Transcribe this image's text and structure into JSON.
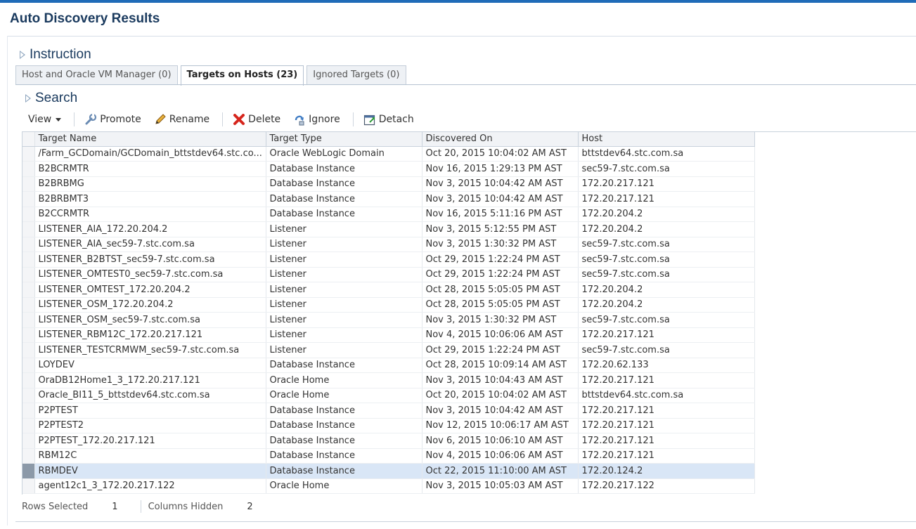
{
  "page": {
    "title": "Auto Discovery Results"
  },
  "instruction": {
    "label": "Instruction"
  },
  "search": {
    "label": "Search"
  },
  "tabs": [
    {
      "label": "Host and Oracle VM Manager (0)",
      "active": false
    },
    {
      "label": "Targets on Hosts (23)",
      "active": true
    },
    {
      "label": "Ignored Targets (0)",
      "active": false
    }
  ],
  "toolbar": {
    "view": "View",
    "promote": "Promote",
    "rename": "Rename",
    "delete": "Delete",
    "ignore": "Ignore",
    "detach": "Detach"
  },
  "table": {
    "columns": [
      "Target Name",
      "Target Type",
      "Discovered On",
      "Host"
    ],
    "rows": [
      [
        "/Farm_GCDomain/GCDomain_bttstdev64.stc.co...",
        "Oracle WebLogic Domain",
        "Oct 20, 2015 10:04:02 AM AST",
        "bttstdev64.stc.com.sa"
      ],
      [
        "B2BCRMTR",
        "Database Instance",
        "Nov 16, 2015 1:29:13 PM AST",
        "sec59-7.stc.com.sa"
      ],
      [
        "B2BRBMG",
        "Database Instance",
        "Nov 3, 2015 10:04:42 AM AST",
        "172.20.217.121"
      ],
      [
        "B2BRBMT3",
        "Database Instance",
        "Nov 3, 2015 10:04:42 AM AST",
        "172.20.217.121"
      ],
      [
        "B2CCRMTR",
        "Database Instance",
        "Nov 16, 2015 5:11:16 PM AST",
        "172.20.204.2"
      ],
      [
        "LISTENER_AIA_172.20.204.2",
        "Listener",
        "Nov 3, 2015 5:12:55 PM AST",
        "172.20.204.2"
      ],
      [
        "LISTENER_AIA_sec59-7.stc.com.sa",
        "Listener",
        "Nov 3, 2015 1:30:32 PM AST",
        "sec59-7.stc.com.sa"
      ],
      [
        "LISTENER_B2BTST_sec59-7.stc.com.sa",
        "Listener",
        "Oct 29, 2015 1:22:24 PM AST",
        "sec59-7.stc.com.sa"
      ],
      [
        "LISTENER_OMTEST0_sec59-7.stc.com.sa",
        "Listener",
        "Oct 29, 2015 1:22:24 PM AST",
        "sec59-7.stc.com.sa"
      ],
      [
        "LISTENER_OMTEST_172.20.204.2",
        "Listener",
        "Oct 28, 2015 5:05:05 PM AST",
        "172.20.204.2"
      ],
      [
        "LISTENER_OSM_172.20.204.2",
        "Listener",
        "Oct 28, 2015 5:05:05 PM AST",
        "172.20.204.2"
      ],
      [
        "LISTENER_OSM_sec59-7.stc.com.sa",
        "Listener",
        "Nov 3, 2015 1:30:32 PM AST",
        "sec59-7.stc.com.sa"
      ],
      [
        "LISTENER_RBM12C_172.20.217.121",
        "Listener",
        "Nov 4, 2015 10:06:06 AM AST",
        "172.20.217.121"
      ],
      [
        "LISTENER_TESTCRMWM_sec59-7.stc.com.sa",
        "Listener",
        "Oct 29, 2015 1:22:24 PM AST",
        "sec59-7.stc.com.sa"
      ],
      [
        "LOYDEV",
        "Database Instance",
        "Oct 28, 2015 10:09:14 AM AST",
        "172.20.62.133"
      ],
      [
        "OraDB12Home1_3_172.20.217.121",
        "Oracle Home",
        "Nov 3, 2015 10:04:43 AM AST",
        "172.20.217.121"
      ],
      [
        "Oracle_BI11_5_bttstdev64.stc.com.sa",
        "Oracle Home",
        "Oct 20, 2015 10:04:02 AM AST",
        "bttstdev64.stc.com.sa"
      ],
      [
        "P2PTEST",
        "Database Instance",
        "Nov 3, 2015 10:04:42 AM AST",
        "172.20.217.121"
      ],
      [
        "P2PTEST2",
        "Database Instance",
        "Nov 12, 2015 10:06:17 AM AST",
        "172.20.217.121"
      ],
      [
        "P2PTEST_172.20.217.121",
        "Database Instance",
        "Nov 6, 2015 10:06:10 AM AST",
        "172.20.217.121"
      ],
      [
        "RBM12C",
        "Database Instance",
        "Nov 4, 2015 10:06:06 AM AST",
        "172.20.217.121"
      ],
      [
        "RBMDEV",
        "Database Instance",
        "Oct 22, 2015 11:10:00 AM AST",
        "172.20.124.2"
      ],
      [
        "agent12c1_3_172.20.217.122",
        "Oracle Home",
        "Nov 3, 2015 10:05:03 AM AST",
        "172.20.217.122"
      ]
    ],
    "selected_row": 21
  },
  "footer": {
    "rows_selected_label": "Rows Selected",
    "rows_selected_value": "1",
    "columns_hidden_label": "Columns Hidden",
    "columns_hidden_value": "2"
  },
  "colors": {
    "accent": "#1f6bb8",
    "title": "#1a3a5e",
    "selected_row": "#d9e6f6"
  },
  "icons": {
    "promote": "wrench-icon",
    "rename": "pencil-icon",
    "delete": "red-x-icon",
    "ignore": "ignore-icon",
    "detach": "detach-icon"
  }
}
